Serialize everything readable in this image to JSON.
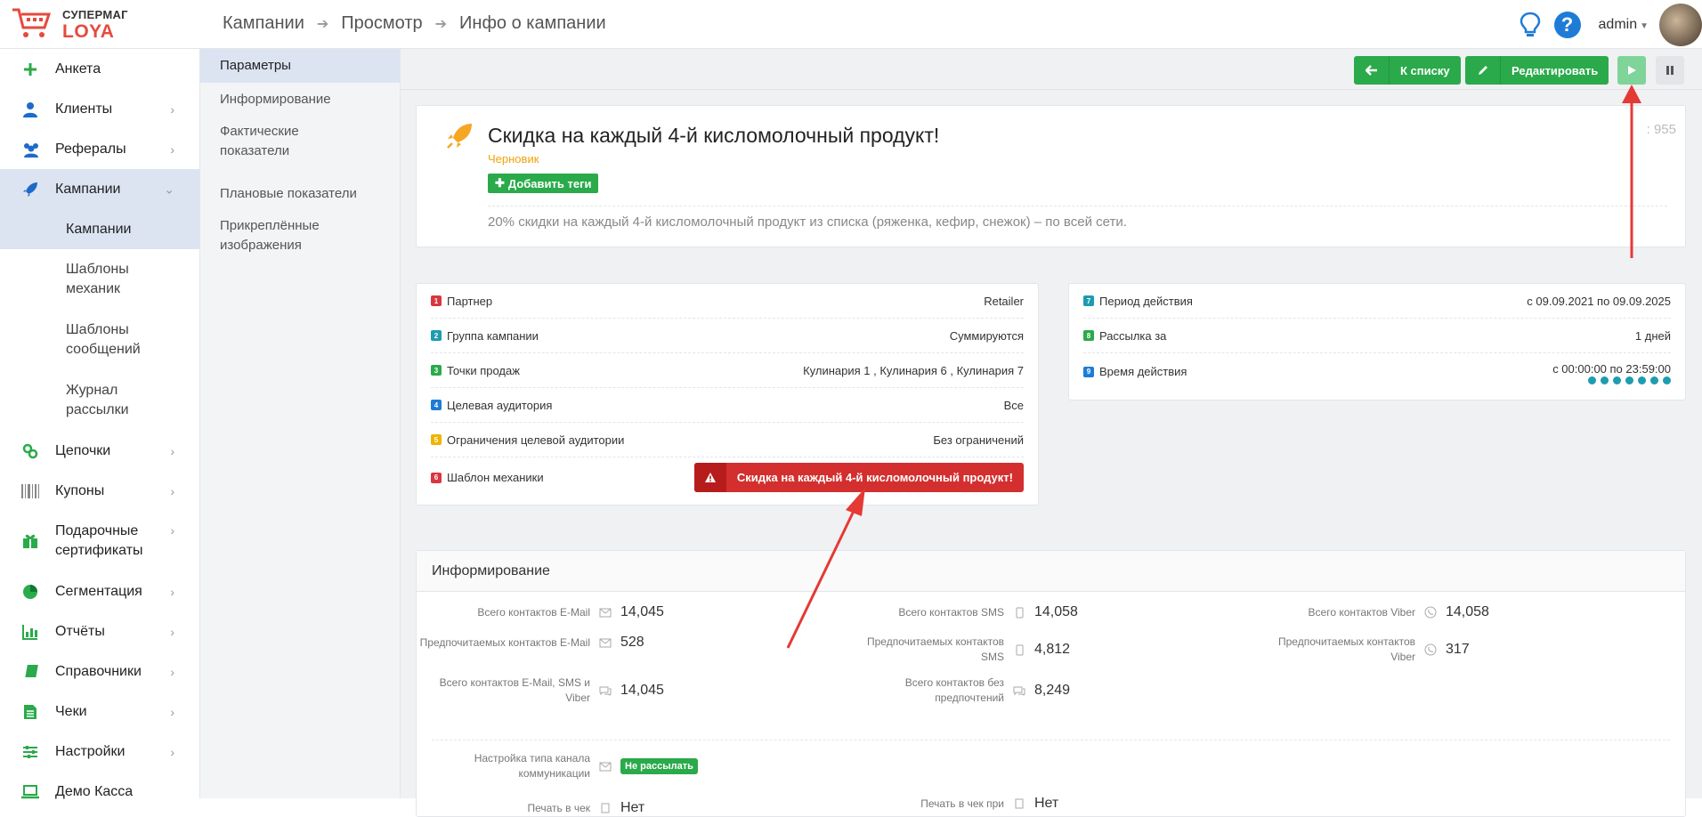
{
  "app": {
    "logo_line1": "СУПЕРМАГ",
    "logo_line2": "LOYA"
  },
  "breadcrumb": [
    "Кампании",
    "Просмотр",
    "Инфо о кампании"
  ],
  "user": {
    "name": "admin"
  },
  "sidebar": {
    "items": [
      {
        "label": "Анкета"
      },
      {
        "label": "Клиенты"
      },
      {
        "label": "Рефералы"
      },
      {
        "label": "Кампании"
      },
      {
        "label": "Цепочки"
      },
      {
        "label": "Купоны"
      },
      {
        "label": "Подарочные сертификаты"
      },
      {
        "label": "Сегментация"
      },
      {
        "label": "Отчёты"
      },
      {
        "label": "Справочники"
      },
      {
        "label": "Чеки"
      },
      {
        "label": "Настройки"
      },
      {
        "label": "Демо Касса"
      }
    ],
    "sub": [
      "Кампании",
      "Шаблоны механик",
      "Шаблоны сообщений",
      "Журнал рассылки"
    ]
  },
  "subnav": [
    "Параметры",
    "Информирование",
    "Фактические показатели",
    "Плановые показатели",
    "Прикреплённые изображения"
  ],
  "toolbar": {
    "back_label": "К списку",
    "edit_label": "Редактировать"
  },
  "campaign": {
    "title": "Скидка на каждый 4-й кисломолочный продукт!",
    "status": "Черновик",
    "add_tags": "Добавить теги",
    "description": "20% скидки на каждый 4-й кисломолочный продукт из списка (ряженка, кефир, снежок) – по всей сети.",
    "id_text": ": 955"
  },
  "params": [
    {
      "num": "1",
      "label": "Партнер",
      "value": "Retailer",
      "color": "#d9363e"
    },
    {
      "num": "2",
      "label": "Группа кампании",
      "value": "Суммируются",
      "color": "#1e9cb0"
    },
    {
      "num": "3",
      "label": "Точки продаж",
      "value": "Кулинария 1 , Кулинария 6 , Кулинария 7",
      "color": "#2aaa4a"
    },
    {
      "num": "4",
      "label": "Целевая аудитория",
      "value": "Все",
      "color": "#1e7cd6"
    },
    {
      "num": "5",
      "label": "Ограничения целевой аудитории",
      "value": "Без ограничений",
      "color": "#f0b400"
    },
    {
      "num": "6",
      "label": "Шаблон механики",
      "value": "Скидка на каждый 4-й кисломолочный продукт!",
      "color": "#d9363e"
    }
  ],
  "params2": [
    {
      "num": "7",
      "label": "Период действия",
      "value": "с 09.09.2021 по 09.09.2025",
      "color": "#1e9cb0"
    },
    {
      "num": "8",
      "label": "Рассылка за",
      "value": "1 дней",
      "color": "#2aaa4a"
    },
    {
      "num": "9",
      "label": "Время действия",
      "value": "с 00:00:00 по 23:59:00",
      "color": "#1e7cd6"
    }
  ],
  "info": {
    "title": "Информирование",
    "stats": [
      {
        "label": "Всего контактов E-Mail",
        "value": "14,045"
      },
      {
        "label": "Всего контактов SMS",
        "value": "14,058"
      },
      {
        "label": "Всего контактов Viber",
        "value": "14,058"
      },
      {
        "label": "Предпочитаемых контактов E-Mail",
        "value": "528"
      },
      {
        "label": "Предпочитаемых контактов SMS",
        "value": "4,812"
      },
      {
        "label": "Предпочитаемых контактов Viber",
        "value": "317"
      },
      {
        "label": "Всего контактов E-Mail, SMS и Viber",
        "value": "14,045"
      },
      {
        "label": "Всего контактов без предпочтений",
        "value": "8,249"
      }
    ],
    "channel_label": "Настройка типа канала коммуникации",
    "channel_badge": "Не рассылать",
    "print1_label": "Печать в чек",
    "print1_value": "Нет",
    "print2_label": "Печать в чек при",
    "print2_value": "Нет"
  },
  "colors": {
    "accent_green": "#2aaa4a",
    "danger": "#d32f2f",
    "brand": "#e64a3d"
  }
}
